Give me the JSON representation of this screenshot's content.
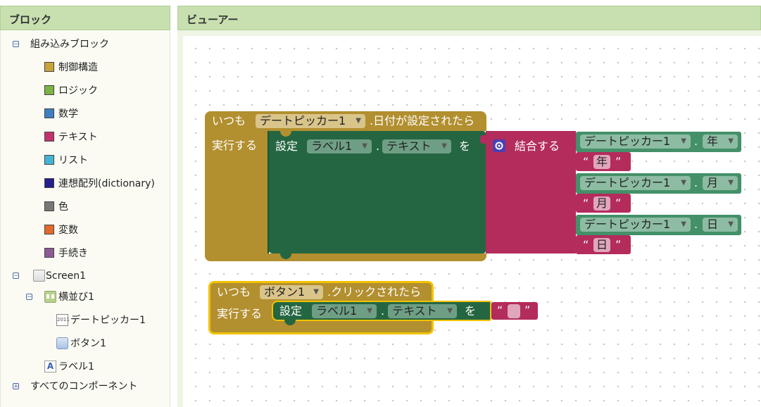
{
  "left_panel": {
    "title": "ブロック",
    "builtin": {
      "label": "組み込みブロック",
      "toggle": "−",
      "items": [
        {
          "label": "制御構造",
          "color": "#c8a33a"
        },
        {
          "label": "ロジック",
          "color": "#7cb342"
        },
        {
          "label": "数学",
          "color": "#3f7ec1"
        },
        {
          "label": "テキスト",
          "color": "#c2336b"
        },
        {
          "label": "リスト",
          "color": "#45b4d4"
        },
        {
          "label": "連想配列(dictionary)",
          "color": "#251f8c"
        },
        {
          "label": "色",
          "color": "#777777"
        },
        {
          "label": "変数",
          "color": "#e26a2c"
        },
        {
          "label": "手続き",
          "color": "#8d5b96"
        }
      ]
    },
    "screen": {
      "label": "Screen1",
      "toggle": "−"
    },
    "arrangement": {
      "label": "横並び1",
      "toggle": "−"
    },
    "datepicker": {
      "label": "デートピッカー1",
      "icon_text": "2011"
    },
    "button": {
      "label": "ボタン1"
    },
    "label_comp": {
      "label": "ラベル1",
      "icon_text": "A"
    },
    "all_components": {
      "label": "すべてのコンポーネント",
      "toggle": "+"
    }
  },
  "viewer": {
    "title": "ビューアー",
    "event1": {
      "when": "いつも",
      "component": "デートピッカー1",
      "event": ".日付が設定されたら",
      "do": "実行する",
      "set": "設定",
      "target": "ラベル1",
      "dot": ".",
      "property": "テキスト",
      "to": "を",
      "join": "結合する",
      "rows": [
        {
          "component": "デートピッカー1",
          "prop": "年",
          "literal": "年"
        },
        {
          "component": "デートピッカー1",
          "prop": "月",
          "literal": "月"
        },
        {
          "component": "デートピッカー1",
          "prop": "日",
          "literal": "日"
        }
      ]
    },
    "event2": {
      "when": "いつも",
      "component": "ボタン1",
      "event": ".クリックされたら",
      "do": "実行する",
      "set": "設定",
      "target": "ラベル1",
      "dot": ".",
      "property": "テキスト",
      "to": "を",
      "literal": ""
    },
    "quote_open": "“",
    "quote_close": "”",
    "dropdown_arrow": "▼",
    "colors": {
      "control": "#b28f2f",
      "control_selected_border": "#f2c200",
      "component_set": "#246641",
      "component_get": "#439069",
      "text": "#b32c5c"
    }
  }
}
